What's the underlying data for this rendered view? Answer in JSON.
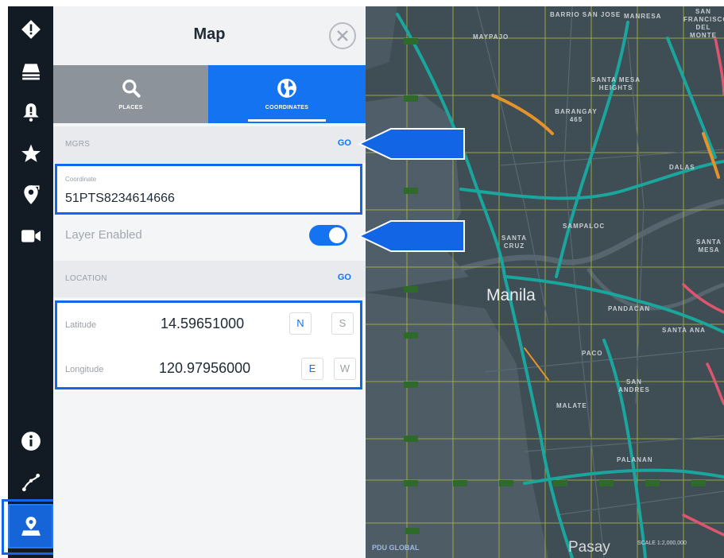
{
  "panel": {
    "title": "Map",
    "tabs": [
      {
        "label": "PLACES",
        "icon": "search-icon",
        "active": false
      },
      {
        "label": "COORDINATES",
        "icon": "globe-icon",
        "active": true
      }
    ]
  },
  "mgrs": {
    "section_label": "MGRS",
    "go_label": "GO",
    "coordinate_label": "Coordinate",
    "coordinate_value": "51PTS8234614666",
    "layer_label": "Layer Enabled",
    "layer_enabled": true
  },
  "location": {
    "section_label": "LOCATION",
    "go_label": "GO",
    "latitude_label": "Latitude",
    "latitude_value": "14.59651000",
    "lat_dirs": [
      "N",
      "S"
    ],
    "longitude_label": "Longitude",
    "longitude_value": "120.97956000",
    "lon_dirs": [
      "E",
      "W"
    ]
  },
  "rail": {
    "icons": [
      "alert-diamond-icon",
      "layers-icon",
      "alert-bell-icon",
      "star-icon",
      "route-pin-icon",
      "video-icon",
      "info-icon",
      "path-icon",
      "map-pin-icon"
    ],
    "active": "map-pin-icon"
  },
  "map": {
    "city": "Manila",
    "district_labels": [
      "BARRIO SAN JOSE",
      "MANRESA",
      "SAN FRANCISCO DEL MONTE",
      "MAYPAJO",
      "SANTA MESA HEIGHTS",
      "BARANGAY 465",
      "SANTA CRUZ",
      "SAMPALOC",
      "SANTA MESA",
      "PANDACAN",
      "SANTA ANA",
      "PACO",
      "SAN ANDRES",
      "MALATE",
      "PALANAN",
      "DALAS"
    ],
    "bottom_city": "Pasay",
    "logo_text": "PDU GLOBAL",
    "scale_text": "SCALE 1:2,000,000",
    "colors": {
      "water": "#4f5e68",
      "land": "#3f4d55",
      "road_teal": "#1aa59d",
      "road_orange": "#e6922a",
      "road_pink": "#e0556e",
      "grid": "#c7d43b"
    }
  }
}
